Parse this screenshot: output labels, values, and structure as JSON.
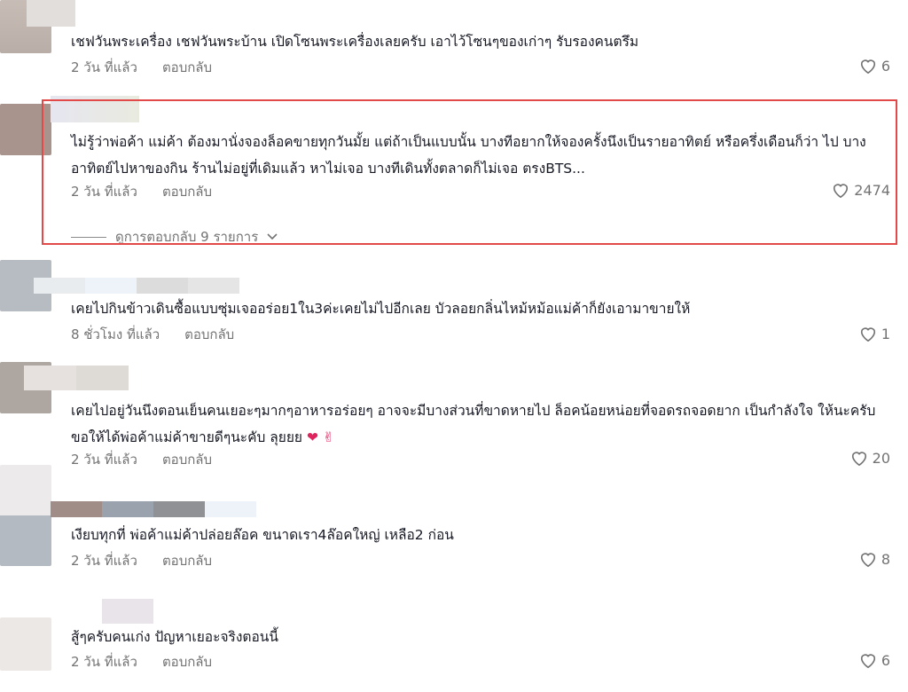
{
  "comments": [
    {
      "text": "เชฟวันพระเครื่อง เชฟวันพระบ้าน เปิดโซนพระเครื่องเลยครับ เอาไว้โซนๆของเก่าๆ รับรองคนตรึม",
      "time": "2 วัน ที่แล้ว",
      "reply": "ตอบกลับ",
      "likes": "6"
    },
    {
      "text": "ไม่รู้ว่าพ่อค้า แม่ค้า ต้องมานั่งจองล็อคขายทุกวันมั้ย แต่ถ้าเป็นแบบนั้น บางทีอยากให้จองครั้งนึงเป็นรายอาทิตย์ หรือครึ่งเดือนก็ว่า ไป บางอาทิตย์ไปหาของกิน ร้านไม่อยู่ที่เดิมแล้ว หาไม่เจอ บางทีเดินทั้งตลาดก็ไม่เจอ ตรงBTS...",
      "time": "2 วัน ที่แล้ว",
      "reply": "ตอบกลับ",
      "likes": "2474",
      "view_replies": "ดูการตอบกลับ 9 รายการ"
    },
    {
      "text": "เคยไปกินข้าวเดินซื้อแบบซุ่มเจออร่อย1ใน3ค่ะเคยไม่ไปอีกเลย บัวลอยกลิ่นไหม้หม้อแม่ค้าก็ยังเอามาขายให้",
      "time": "8 ชั่วโมง ที่แล้ว",
      "reply": "ตอบกลับ",
      "likes": "1"
    },
    {
      "text": "เคยไปอยู่วันนึงตอนเย็นคนเยอะๆมากๆอาหารอร่อยๆ อาจจะมีบางส่วนที่ขาดหายไป ล็อคน้อยหน่อยที่จอดรถจอดยาก เป็นกำลังใจ ให้นะครับ ขอให้ได้พ่อค้าแม่ค้าขายดีๆนะคับ ลุยยย",
      "emoji": "❤ ✌",
      "time": "2 วัน ที่แล้ว",
      "reply": "ตอบกลับ",
      "likes": "20"
    },
    {
      "text": "เงียบทุกที่ พ่อค้าแม่ค้าปล่อยล๊อค ขนาดเรา4ล๊อคใหญ่ เหลือ2 ก่อน",
      "time": "2 วัน ที่แล้ว",
      "reply": "ตอบกลับ",
      "likes": "8"
    },
    {
      "text": "สู้ๆครับคนเก่ง ปัญหาเยอะจริงตอนนี้",
      "time": "2 วัน ที่แล้ว",
      "reply": "ตอบกลับ",
      "likes": "6"
    }
  ],
  "colors": {
    "highlight": "#e24a4a",
    "meta": "#737373",
    "text": "#161823"
  },
  "icons": {
    "like": "heart-outline-icon",
    "expand": "chevron-down-icon"
  }
}
